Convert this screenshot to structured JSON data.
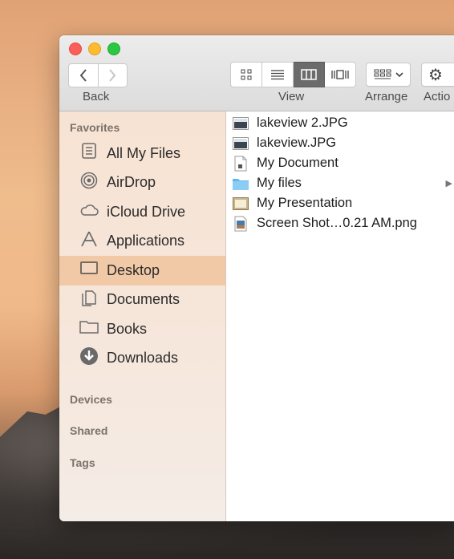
{
  "toolbar": {
    "back_label": "Back",
    "view_label": "View",
    "arrange_label": "Arrange",
    "action_label": "Actio"
  },
  "sidebar": {
    "favorites_header": "Favorites",
    "items": [
      {
        "label": "All My Files",
        "icon": "all-files-icon"
      },
      {
        "label": "AirDrop",
        "icon": "airdrop-icon"
      },
      {
        "label": "iCloud Drive",
        "icon": "cloud-icon"
      },
      {
        "label": "Applications",
        "icon": "applications-icon"
      },
      {
        "label": "Desktop",
        "icon": "desktop-icon",
        "selected": true
      },
      {
        "label": "Documents",
        "icon": "documents-icon"
      },
      {
        "label": "Books",
        "icon": "folder-icon"
      },
      {
        "label": "Downloads",
        "icon": "downloads-icon"
      }
    ],
    "devices_header": "Devices",
    "shared_header": "Shared",
    "tags_header": "Tags"
  },
  "files": [
    {
      "name": "lakeview 2.JPG",
      "icon": "image-file-icon"
    },
    {
      "name": "lakeview.JPG",
      "icon": "image-file-icon"
    },
    {
      "name": "My Document",
      "icon": "document-file-icon"
    },
    {
      "name": "My files",
      "icon": "folder-icon",
      "has_children": true
    },
    {
      "name": "My Presentation",
      "icon": "presentation-file-icon"
    },
    {
      "name": "Screen Shot…0.21 AM.png",
      "icon": "png-file-icon"
    }
  ],
  "colors": {
    "sidebar_selected": "#f1c9a7",
    "close": "#fc5f57",
    "minimize": "#fdbc2e",
    "zoom": "#29c840"
  }
}
